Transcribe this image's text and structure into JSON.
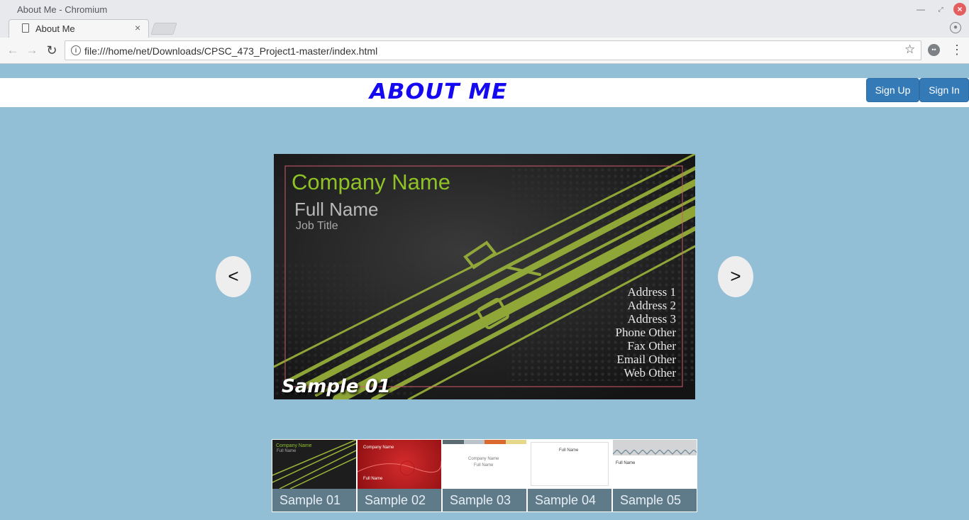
{
  "browser": {
    "window_title": "About Me - Chromium",
    "tab_title": "About Me",
    "url": "file:///home/net/Downloads/CPSC_473_Project1-master/index.html"
  },
  "header": {
    "title": "ABOUT ME",
    "signup_label": "Sign Up",
    "signin_label": "Sign In"
  },
  "carousel": {
    "prev_label": "<",
    "next_label": ">",
    "slide": {
      "company": "Company Name",
      "full_name": "Full Name",
      "job_title": "Job Title",
      "address_lines": [
        "Address 1",
        "Address 2",
        "Address 3",
        "Phone Other",
        "Fax Other",
        "Email Other",
        "Web Other"
      ],
      "caption": "Sample 01"
    }
  },
  "thumbnails": [
    {
      "label": "Sample 01",
      "company": "Company Name",
      "name": "Full Name"
    },
    {
      "label": "Sample 02",
      "company": "Company Name",
      "name": "Full Name"
    },
    {
      "label": "Sample 03",
      "company": "Company Name",
      "name": "Full Name"
    },
    {
      "label": "Sample 04",
      "company": "",
      "name": "Full Name"
    },
    {
      "label": "Sample 05",
      "company": "",
      "name": "Full Name"
    }
  ],
  "colors": {
    "page_background": "#92bfd6",
    "title_blue": "#1409f0",
    "button_blue": "#337ab7",
    "card_green": "#8fc226",
    "card_frame": "#d35a6a"
  }
}
